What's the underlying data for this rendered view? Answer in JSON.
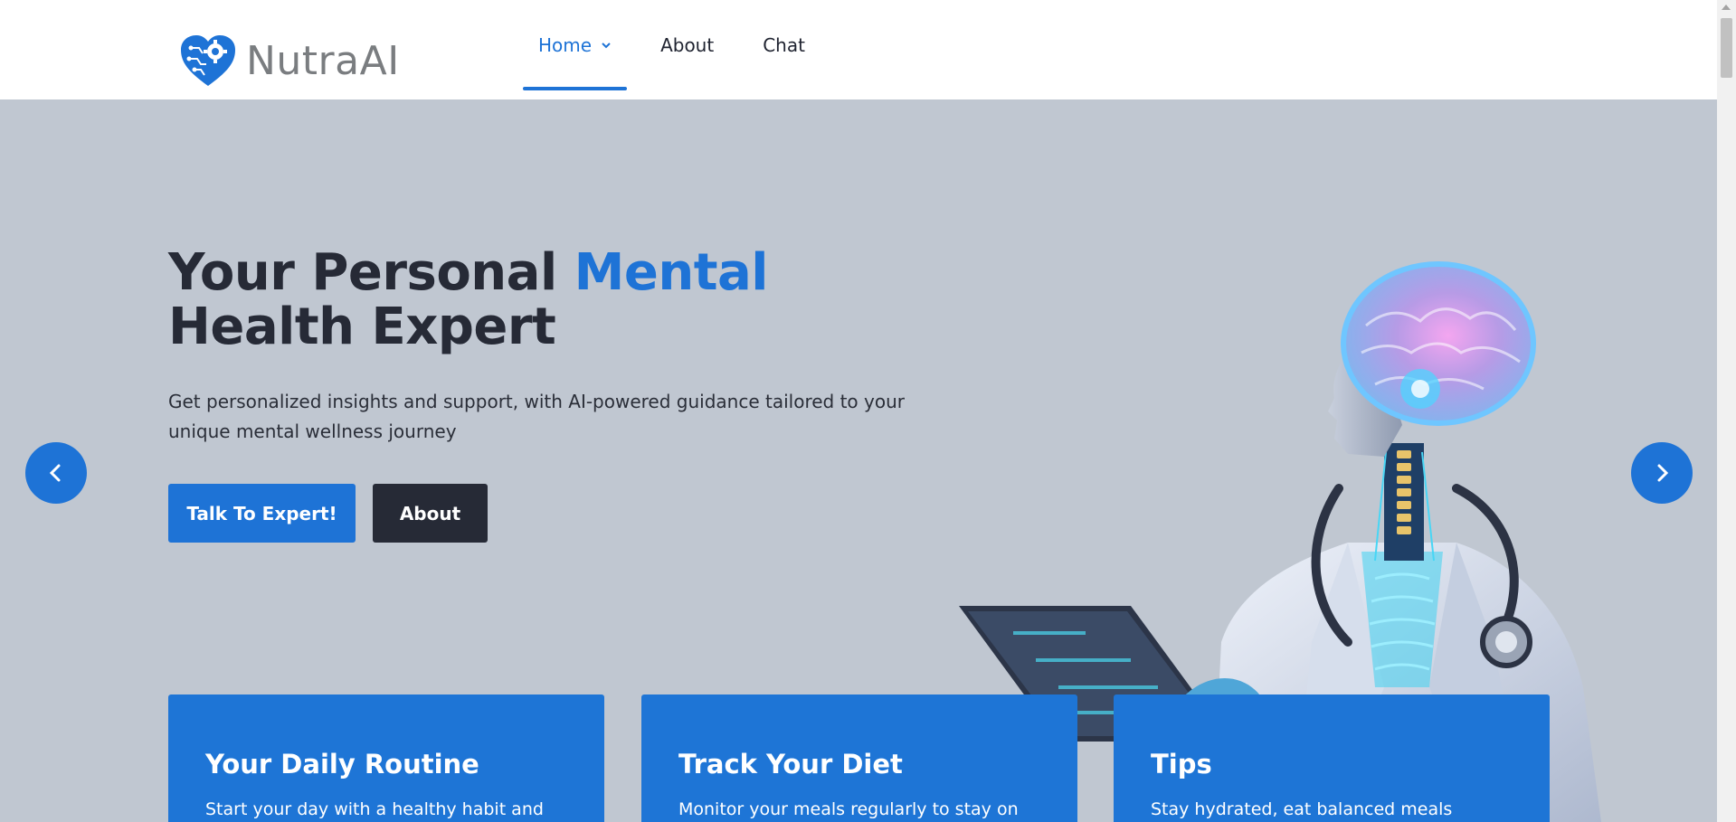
{
  "brand": {
    "name": "NutraAI"
  },
  "nav": {
    "items": [
      {
        "label": "Home",
        "active": true,
        "has_dropdown": true
      },
      {
        "label": "About",
        "active": false
      },
      {
        "label": "Chat",
        "active": false
      }
    ]
  },
  "hero": {
    "title_part1": "Your Personal",
    "title_accent": "Mental",
    "title_part2": "Health Expert",
    "subtitle": "Get personalized insights and support, with AI-powered guidance tailored to your unique mental wellness journey",
    "primary_button": "Talk To Expert!",
    "secondary_button": "About"
  },
  "cards": [
    {
      "title": "Your Daily Routine",
      "text": "Start your day with a healthy habit and"
    },
    {
      "title": "Track Your Diet",
      "text": "Monitor your meals regularly to stay on"
    },
    {
      "title": "Tips",
      "text": "Stay hydrated, eat balanced meals"
    }
  ],
  "colors": {
    "accent": "#1e73d6",
    "dark": "#262a36",
    "hero_background": "#c0c7d1",
    "card_background": "#1e75d6"
  },
  "icons": {
    "logo": "heart-gear-circuit-icon",
    "prev": "chevron-left-icon",
    "next": "chevron-right-icon",
    "dropdown": "chevron-down-icon"
  }
}
